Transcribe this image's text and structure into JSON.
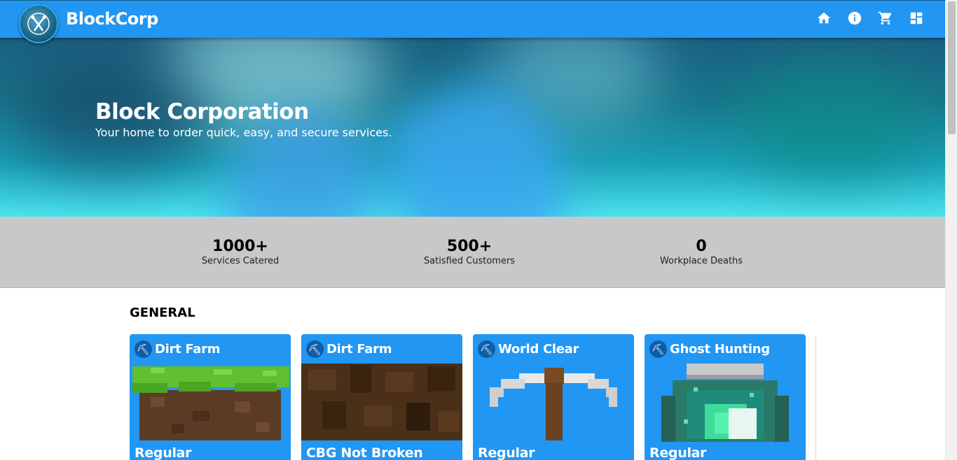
{
  "brand": {
    "name": "BlockCorp"
  },
  "nav": {
    "icons": [
      "home-icon",
      "info-icon",
      "cart-icon",
      "dashboard-icon"
    ]
  },
  "hero": {
    "title": "Block Corporation",
    "subtitle": "Your home to order quick, easy, and secure services."
  },
  "stats": [
    {
      "value": "1000+",
      "label": "Services Catered"
    },
    {
      "value": "500+",
      "label": "Satisfied Customers"
    },
    {
      "value": "0",
      "label": "Workplace Deaths"
    }
  ],
  "section": {
    "title": "GENERAL"
  },
  "cards": [
    {
      "title": "Dirt Farm",
      "tier": "Regular",
      "image": "grass-block"
    },
    {
      "title": "Dirt Farm",
      "tier": "CBG Not Broken",
      "image": "dirt-block"
    },
    {
      "title": "World Clear",
      "tier": "Regular",
      "image": "pickaxe"
    },
    {
      "title": "Ghost Hunting",
      "tier": "Regular",
      "image": "potion-jar"
    }
  ],
  "colors": {
    "primary": "#2196f3",
    "stats_bg": "#c8c8c8",
    "badge": "#0e5da8"
  }
}
